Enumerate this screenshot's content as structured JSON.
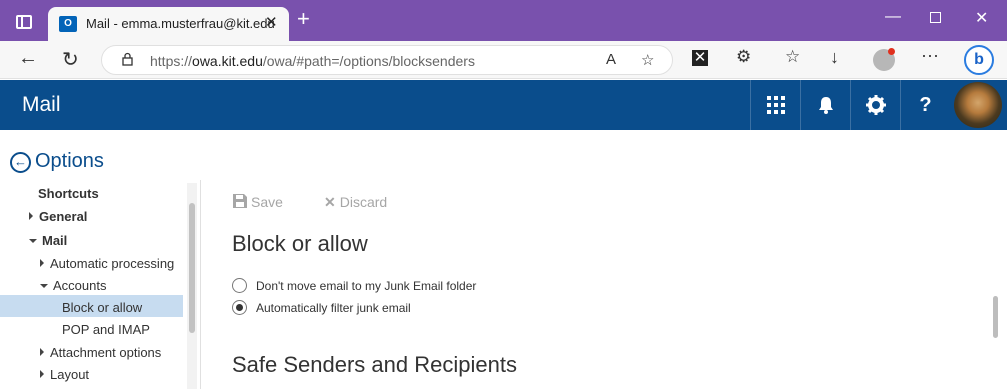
{
  "browser": {
    "tab_title": "Mail - emma.musterfrau@kit.edu",
    "favicon_text": "O",
    "url_prefix": "https://",
    "url_host": "owa.kit.edu",
    "url_path": "/owa/#path=/options/blocksenders"
  },
  "owa": {
    "app_title": "Mail",
    "help_label": "?"
  },
  "options": {
    "title": "Options"
  },
  "nav": {
    "items": [
      {
        "label": "Shortcuts"
      },
      {
        "label": "General"
      },
      {
        "label": "Mail"
      },
      {
        "label": "Automatic processing"
      },
      {
        "label": "Accounts"
      },
      {
        "label": "Block or allow"
      },
      {
        "label": "POP and IMAP"
      },
      {
        "label": "Attachment options"
      },
      {
        "label": "Layout"
      }
    ]
  },
  "content": {
    "save_label": "Save",
    "discard_label": "Discard",
    "section_title": "Block or allow",
    "radio_1": "Don't move email to my Junk Email folder",
    "radio_2": "Automatically filter junk email",
    "section2_title": "Safe Senders and Recipients"
  },
  "colors": {
    "browser_accent": "#7951ad",
    "owa_header": "#0a4d8c",
    "nav_selected": "#c7dcf0"
  }
}
